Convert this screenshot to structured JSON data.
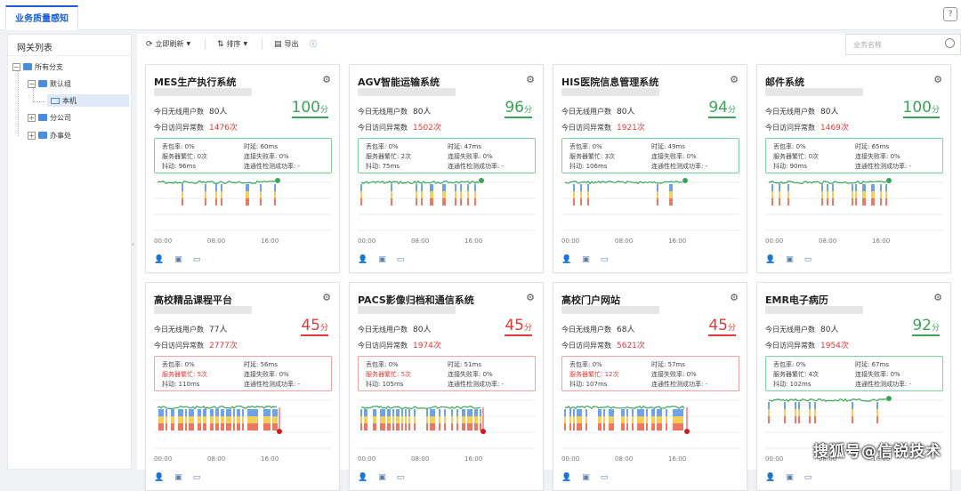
{
  "tab": {
    "label": "业务质量感知"
  },
  "help_icon": "question-icon",
  "sidebar": {
    "title": "网关列表",
    "tree": {
      "root": "所有分支",
      "default_group": "默认组",
      "local": "本机",
      "branch": "分公司",
      "office": "办事处"
    }
  },
  "toolbar": {
    "refresh": "立即刷新",
    "sort": "排序",
    "export": "导出",
    "search_placeholder": "业务名称"
  },
  "labels": {
    "users": "今日无线用户数",
    "visits": "今日访问异常数",
    "loss": "丢包率:",
    "server": "服务器繁忙:",
    "jitter": "抖动:",
    "latency": "时延:",
    "conn_fail": "连接失败率:",
    "connectivity": "连通性检测成功率:",
    "x0": "00:00",
    "x1": "08:00",
    "x2": "16:00"
  },
  "colors": {
    "good": "#3aa557",
    "bad": "#e03b3b",
    "accent": "#1d5fd1"
  },
  "cards": [
    {
      "name": "MES生产执行系统",
      "score": "100",
      "unit": "分",
      "status": "good",
      "users": "80人",
      "visits": "1476次",
      "loss": "0%",
      "server": "0次",
      "jitter": "96ms",
      "latency": "60ms",
      "conn_fail": "0%",
      "connectivity": "-"
    },
    {
      "name": "AGV智能运输系统",
      "score": "96",
      "unit": "分",
      "status": "good",
      "users": "80人",
      "visits": "1502次",
      "loss": "0%",
      "server": "2次",
      "jitter": "75ms",
      "latency": "47ms",
      "conn_fail": "0%",
      "connectivity": "-"
    },
    {
      "name": "HIS医院信息管理系统",
      "score": "94",
      "unit": "分",
      "status": "good",
      "users": "80人",
      "visits": "1921次",
      "loss": "0%",
      "server": "3次",
      "jitter": "106ms",
      "latency": "49ms",
      "conn_fail": "0%",
      "connectivity": "-"
    },
    {
      "name": "邮件系统",
      "score": "100",
      "unit": "分",
      "status": "good",
      "users": "80人",
      "visits": "1469次",
      "loss": "0%",
      "server": "0次",
      "jitter": "90ms",
      "latency": "65ms",
      "conn_fail": "0%",
      "connectivity": "-"
    },
    {
      "name": "高校精品课程平台",
      "score": "45",
      "unit": "分",
      "status": "bad",
      "users": "77人",
      "visits": "2777次",
      "loss": "0%",
      "server": "5次",
      "jitter": "110ms",
      "latency": "56ms",
      "conn_fail": "0%",
      "connectivity": "-"
    },
    {
      "name": "PACS影像归档和通信系统",
      "score": "45",
      "unit": "分",
      "status": "bad",
      "users": "80人",
      "visits": "1974次",
      "loss": "0%",
      "server": "5次",
      "jitter": "105ms",
      "latency": "51ms",
      "conn_fail": "0%",
      "connectivity": "-"
    },
    {
      "name": "高校门户网站",
      "score": "45",
      "unit": "分",
      "status": "bad",
      "users": "68人",
      "visits": "5621次",
      "loss": "0%",
      "server": "12次",
      "jitter": "107ms",
      "latency": "57ms",
      "conn_fail": "0%",
      "connectivity": "-"
    },
    {
      "name": "EMR电子病历",
      "score": "92",
      "unit": "分",
      "status": "good",
      "users": "80人",
      "visits": "1954次",
      "loss": "0%",
      "server": "4次",
      "jitter": "102ms",
      "latency": "67ms",
      "conn_fail": "0%",
      "connectivity": "-"
    }
  ],
  "footer_icons": [
    "user-icon",
    "server-icon",
    "network-icon"
  ],
  "watermark": "搜狐号@信锐技术"
}
